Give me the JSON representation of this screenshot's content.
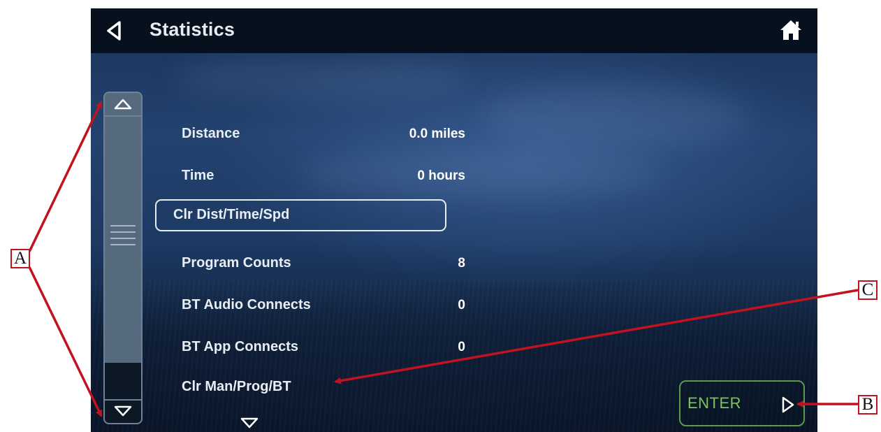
{
  "header": {
    "title": "Statistics",
    "back_icon": "back-triangle-icon",
    "home_icon": "home-icon"
  },
  "list": {
    "items": [
      {
        "label": "Distance",
        "value": "0.0 miles"
      },
      {
        "label": "Time",
        "value": "0 hours"
      },
      {
        "label": "Clr Dist/Time/Spd",
        "value": "",
        "selected": true
      },
      {
        "label": "Program Counts",
        "value": "8"
      },
      {
        "label": "BT Audio Connects",
        "value": "0"
      },
      {
        "label": "BT App Connects",
        "value": "0"
      },
      {
        "label": "Clr Man/Prog/BT",
        "value": ""
      }
    ]
  },
  "enter_button": {
    "label": "ENTER"
  },
  "annotations": {
    "a": "A",
    "b": "B",
    "c": "C"
  },
  "colors": {
    "annotation_red": "#c1121f",
    "enter_green": "#7fc35e",
    "topbar": "#07101d"
  }
}
